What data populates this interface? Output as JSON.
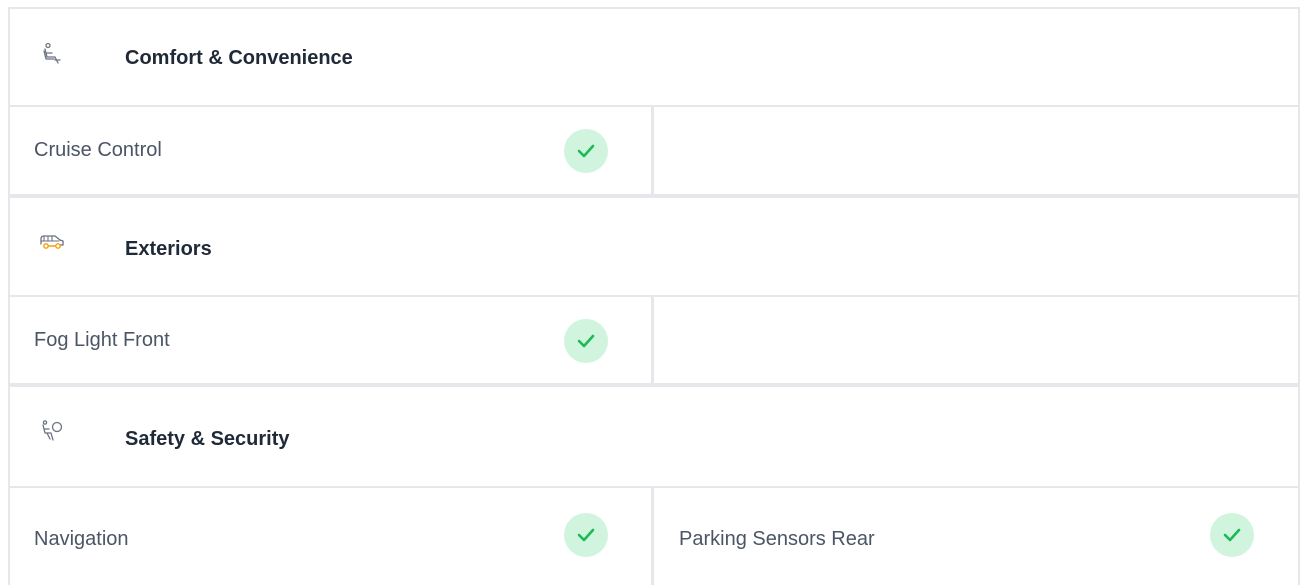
{
  "sections": [
    {
      "title": "Comfort & Convenience",
      "icon": "seat-icon",
      "features": [
        {
          "label": "Cruise Control",
          "available": true
        }
      ]
    },
    {
      "title": "Exteriors",
      "icon": "car-icon",
      "features": [
        {
          "label": "Fog Light Front",
          "available": true
        }
      ]
    },
    {
      "title": "Safety & Security",
      "icon": "airbag-icon",
      "features": [
        {
          "label": "Navigation",
          "available": true
        },
        {
          "label": "Parking Sensors Rear",
          "available": true
        }
      ]
    }
  ],
  "colors": {
    "check": "#1db954",
    "check_bg": "#d1f4df",
    "border": "#e5e7eb",
    "icon_stroke": "#6b7280",
    "icon_accent": "#f59e0b"
  }
}
